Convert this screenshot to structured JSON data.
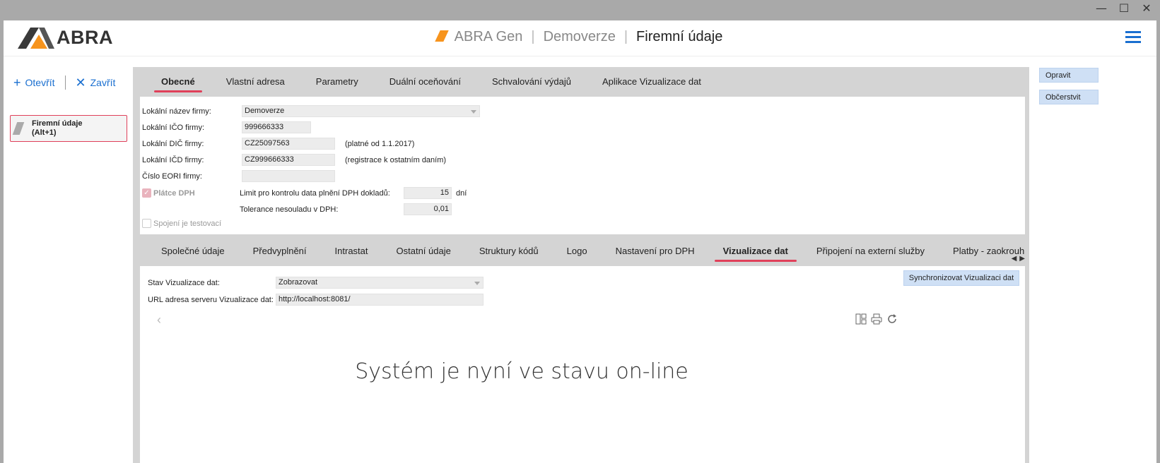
{
  "window": {
    "controls": [
      "—",
      "☐",
      "✕"
    ]
  },
  "header": {
    "logo_text": "ABRA",
    "product": "ABRA Gen",
    "database": "Demoverze",
    "current": "Firemní údaje"
  },
  "left_panel": {
    "open_label": "Otevřít",
    "close_label": "Zavřít",
    "doc_tab_label": "Firemní údaje\n(Alt+1)"
  },
  "tabs_top": [
    {
      "label": "Obecné",
      "active": true
    },
    {
      "label": "Vlastní adresa",
      "active": false
    },
    {
      "label": "Parametry",
      "active": false
    },
    {
      "label": "Duální oceňování",
      "active": false
    },
    {
      "label": "Schvalování výdajů",
      "active": false
    },
    {
      "label": "Aplikace Vizualizace dat",
      "active": false
    }
  ],
  "form": {
    "local_name_label": "Lokální název firmy:",
    "local_name_value": "Demoverze",
    "ico_label": "Lokální IČO firmy:",
    "ico_value": "999666333",
    "dic_label": "Lokální DIČ firmy:",
    "dic_value": "CZ25097563",
    "dic_note": "(platné od 1.1.2017)",
    "icd_label": "Lokální IČD firmy:",
    "icd_value": "CZ999666333",
    "icd_note": "(registrace k ostatním daním)",
    "eori_label": "Číslo EORI firmy:",
    "eori_value": "",
    "vat_payer_label": "Plátce DPH",
    "vat_payer_checked": true,
    "limit_label": "Limit pro kontrolu data plnění DPH dokladů:",
    "limit_value": "15",
    "limit_unit": "dní",
    "tolerance_label": "Tolerance nesouladu v DPH:",
    "tolerance_value": "0,01",
    "test_conn_label": "Spojení je testovací",
    "test_conn_checked": false
  },
  "tabs_bottom": [
    {
      "label": "Společné údaje",
      "active": false
    },
    {
      "label": "Předvyplnění",
      "active": false
    },
    {
      "label": "Intrastat",
      "active": false
    },
    {
      "label": "Ostatní údaje",
      "active": false
    },
    {
      "label": "Struktury kódů",
      "active": false
    },
    {
      "label": "Logo",
      "active": false
    },
    {
      "label": "Nastavení pro DPH",
      "active": false
    },
    {
      "label": "Vizualizace dat",
      "active": true
    },
    {
      "label": "Připojení na externí služby",
      "active": false
    },
    {
      "label": "Platby - zaokrouhlova",
      "active": false
    }
  ],
  "viz": {
    "state_label": "Stav Vizualizace dat:",
    "state_value": "Zobrazovat",
    "url_label": "URL adresa serveru Vizualizace dat:",
    "url_value": "http://localhost:8081/",
    "sync_button": "Synchronizovat Vizualizaci dat",
    "status_text": "Systém je nyní ve stavu on-line"
  },
  "right_panel": {
    "edit_label": "Opravit",
    "refresh_label": "Občerstvit"
  },
  "colors": {
    "accent": "#e0405a",
    "link": "#1a6fd0",
    "logo_orange": "#f7941d",
    "button_bg": "#cfe0f5"
  }
}
